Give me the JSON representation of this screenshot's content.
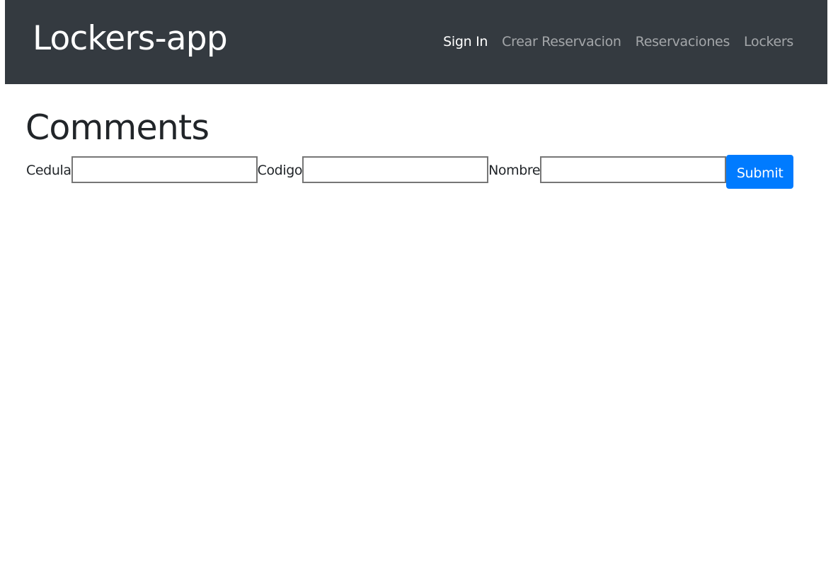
{
  "navbar": {
    "brand": "Lockers-app",
    "links": [
      {
        "label": "Sign In",
        "active": true
      },
      {
        "label": "Crear Reservacion",
        "active": false
      },
      {
        "label": "Reservaciones",
        "active": false
      },
      {
        "label": "Lockers",
        "active": false
      }
    ]
  },
  "main": {
    "title": "Comments",
    "form": {
      "fields": [
        {
          "label": "Cedula",
          "value": "",
          "placeholder": ""
        },
        {
          "label": "Codigo",
          "value": "",
          "placeholder": ""
        },
        {
          "label": "Nombre",
          "value": "",
          "placeholder": ""
        }
      ],
      "submit_label": "Submit"
    }
  },
  "colors": {
    "navbar_bg": "#343a40",
    "active_link": "#ffffff",
    "inactive_link": "rgba(255,255,255,0.55)",
    "primary": "#007bff"
  }
}
